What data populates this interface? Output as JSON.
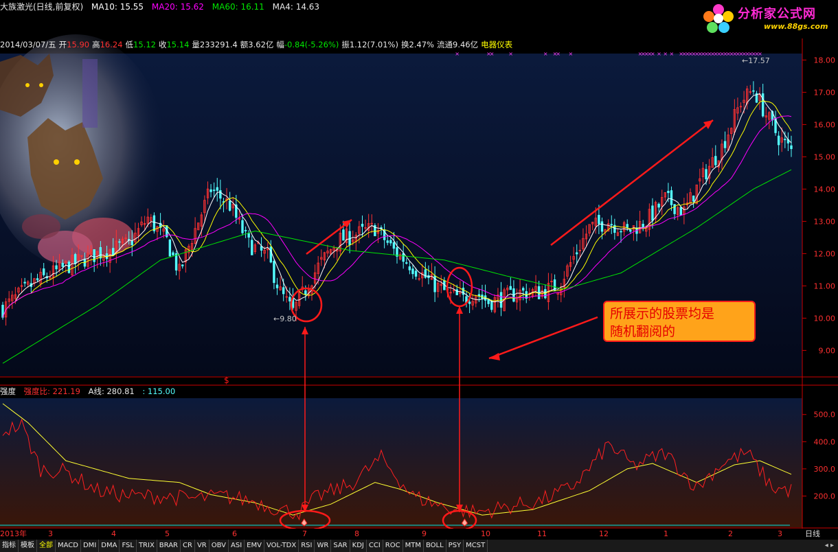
{
  "header": {
    "stock_title": "大族激光(日线,前复权)",
    "ma10": "MA10: 15.55",
    "ma20": "MA20: 15.62",
    "ma60": "MA60: 16.11",
    "ma4": "MA4: 14.63"
  },
  "logo": {
    "title": "分析家公式网",
    "url": "www.88gs.com"
  },
  "info": {
    "date": "2014/03/07/五",
    "open_label": "开",
    "open": "15.90",
    "high_label": "高",
    "high": "16.24",
    "low_label": "低",
    "low": "15.12",
    "close_label": "收",
    "close": "15.14",
    "vol_label": "量",
    "vol": "233291.4",
    "amount_label": "额",
    "amount": "3.62亿",
    "chg_label": "幅",
    "chg": "-0.84(-5.26%)",
    "amp_label": "振",
    "amp": "1.12(7.01%)",
    "turn_label": "换",
    "turn": "2.47%",
    "float_label": "流通",
    "float": "9.46亿",
    "sector": "电器仪表"
  },
  "indicator": {
    "name": "强度",
    "ratio": "强度比: 221.19",
    "aline": "A线: 280.81",
    "third": ": 115.00"
  },
  "annotation": {
    "line1": "所展示的股票均是",
    "line2": "随机翻阅的"
  },
  "colors": {
    "up": "#ff3232",
    "down": "#54ffff",
    "ma10": "#ffffff",
    "ma20": "#ffff00",
    "ma60": "#ff00ff",
    "ma_long": "#00e600",
    "axis": "#cc0000",
    "label": "#ff3030"
  },
  "tabs": [
    "指标",
    "模板",
    "全部",
    "MACD",
    "DMI",
    "DMA",
    "FSL",
    "TRIX",
    "BRAR",
    "CR",
    "VR",
    "OBV",
    "ASI",
    "EMV",
    "VOL-TDX",
    "RSI",
    "WR",
    "SAR",
    "KDJ",
    "CCI",
    "ROC",
    "MTM",
    "BOLL",
    "PSY",
    "MCST"
  ],
  "tabs_more": "◂ ▸",
  "period_label": "日线",
  "chart_data": [
    {
      "type": "candlestick",
      "title": "大族激光(日线,前复权)",
      "ylim": [
        8.2,
        18.2
      ],
      "yticks": [
        9.0,
        10.0,
        11.0,
        12.0,
        13.0,
        14.0,
        15.0,
        16.0,
        17.0,
        18.0
      ],
      "ytick_labels": [
        "9.00",
        "10.00",
        "11.00",
        "12.00",
        "13.00",
        "14.00",
        "15.00",
        "16.00",
        "17.00",
        "18.00"
      ],
      "x_labels": [
        "2013年",
        "3",
        "4",
        "5",
        "6",
        "7",
        "8",
        "9",
        "10",
        "11",
        "12",
        "1",
        "2",
        "3"
      ],
      "low_label": "9.80",
      "high_label": "17.57",
      "anchors": [
        [
          0,
          10.3
        ],
        [
          10,
          11.1
        ],
        [
          20,
          11.6
        ],
        [
          30,
          12.0
        ],
        [
          40,
          12.3
        ],
        [
          46,
          13.1
        ],
        [
          52,
          12.4
        ],
        [
          56,
          11.4
        ],
        [
          60,
          12.5
        ],
        [
          66,
          14.0
        ],
        [
          72,
          13.5
        ],
        [
          78,
          12.3
        ],
        [
          84,
          11.9
        ],
        [
          88,
          10.8
        ],
        [
          92,
          10.2
        ],
        [
          96,
          10.9
        ],
        [
          100,
          11.6
        ],
        [
          106,
          12.4
        ],
        [
          112,
          12.6
        ],
        [
          118,
          12.8
        ],
        [
          124,
          12.1
        ],
        [
          130,
          11.6
        ],
        [
          136,
          11.1
        ],
        [
          142,
          10.7
        ],
        [
          146,
          10.6
        ],
        [
          150,
          10.8
        ],
        [
          154,
          10.5
        ],
        [
          158,
          10.6
        ],
        [
          164,
          10.8
        ],
        [
          170,
          10.8
        ],
        [
          176,
          11.0
        ],
        [
          180,
          11.7
        ],
        [
          186,
          12.8
        ],
        [
          192,
          13.0
        ],
        [
          198,
          12.7
        ],
        [
          204,
          13.0
        ],
        [
          210,
          13.7
        ],
        [
          216,
          13.3
        ],
        [
          222,
          14.4
        ],
        [
          228,
          15.3
        ],
        [
          234,
          16.7
        ],
        [
          238,
          17.1
        ],
        [
          242,
          16.3
        ],
        [
          246,
          15.6
        ],
        [
          250,
          15.2
        ]
      ],
      "ma_long_anchors": [
        [
          0,
          8.6
        ],
        [
          30,
          10.4
        ],
        [
          50,
          11.8
        ],
        [
          80,
          12.7
        ],
        [
          110,
          12.1
        ],
        [
          140,
          11.8
        ],
        [
          160,
          11.3
        ],
        [
          178,
          10.9
        ],
        [
          196,
          11.4
        ],
        [
          220,
          12.8
        ],
        [
          238,
          14.0
        ],
        [
          250,
          14.6
        ]
      ]
    },
    {
      "type": "line",
      "title": "强度",
      "ylim": [
        90,
        560
      ],
      "yticks": [
        200,
        300,
        400,
        500
      ],
      "ytick_labels": [
        "200.0",
        "300.0",
        "400.0",
        "500.0"
      ],
      "series": [
        {
          "name": "A线",
          "anchors": [
            [
              0,
              540
            ],
            [
              8,
              470
            ],
            [
              20,
              330
            ],
            [
              40,
              265
            ],
            [
              56,
              250
            ],
            [
              66,
              205
            ],
            [
              80,
              175
            ],
            [
              92,
              130
            ],
            [
              104,
              170
            ],
            [
              118,
              250
            ],
            [
              126,
              225
            ],
            [
              138,
              175
            ],
            [
              152,
              130
            ],
            [
              168,
              150
            ],
            [
              186,
              220
            ],
            [
              198,
              300
            ],
            [
              206,
              320
            ],
            [
              220,
              250
            ],
            [
              232,
              315
            ],
            [
              240,
              330
            ],
            [
              250,
              280
            ]
          ]
        },
        {
          "name": "强度比",
          "anchors": [
            [
              0,
              440
            ],
            [
              6,
              460
            ],
            [
              12,
              300
            ],
            [
              20,
              290
            ],
            [
              30,
              220
            ],
            [
              40,
              200
            ],
            [
              50,
              200
            ],
            [
              60,
              190
            ],
            [
              70,
              200
            ],
            [
              80,
              180
            ],
            [
              88,
              150
            ],
            [
              94,
              140
            ],
            [
              100,
              200
            ],
            [
              110,
              240
            ],
            [
              120,
              340
            ],
            [
              130,
              200
            ],
            [
              140,
              160
            ],
            [
              150,
              140
            ],
            [
              160,
              160
            ],
            [
              170,
              180
            ],
            [
              180,
              230
            ],
            [
              186,
              300
            ],
            [
              192,
              390
            ],
            [
              200,
              310
            ],
            [
              210,
              360
            ],
            [
              220,
              230
            ],
            [
              228,
              320
            ],
            [
              236,
              360
            ],
            [
              244,
              230
            ],
            [
              250,
              220
            ]
          ]
        }
      ]
    }
  ]
}
